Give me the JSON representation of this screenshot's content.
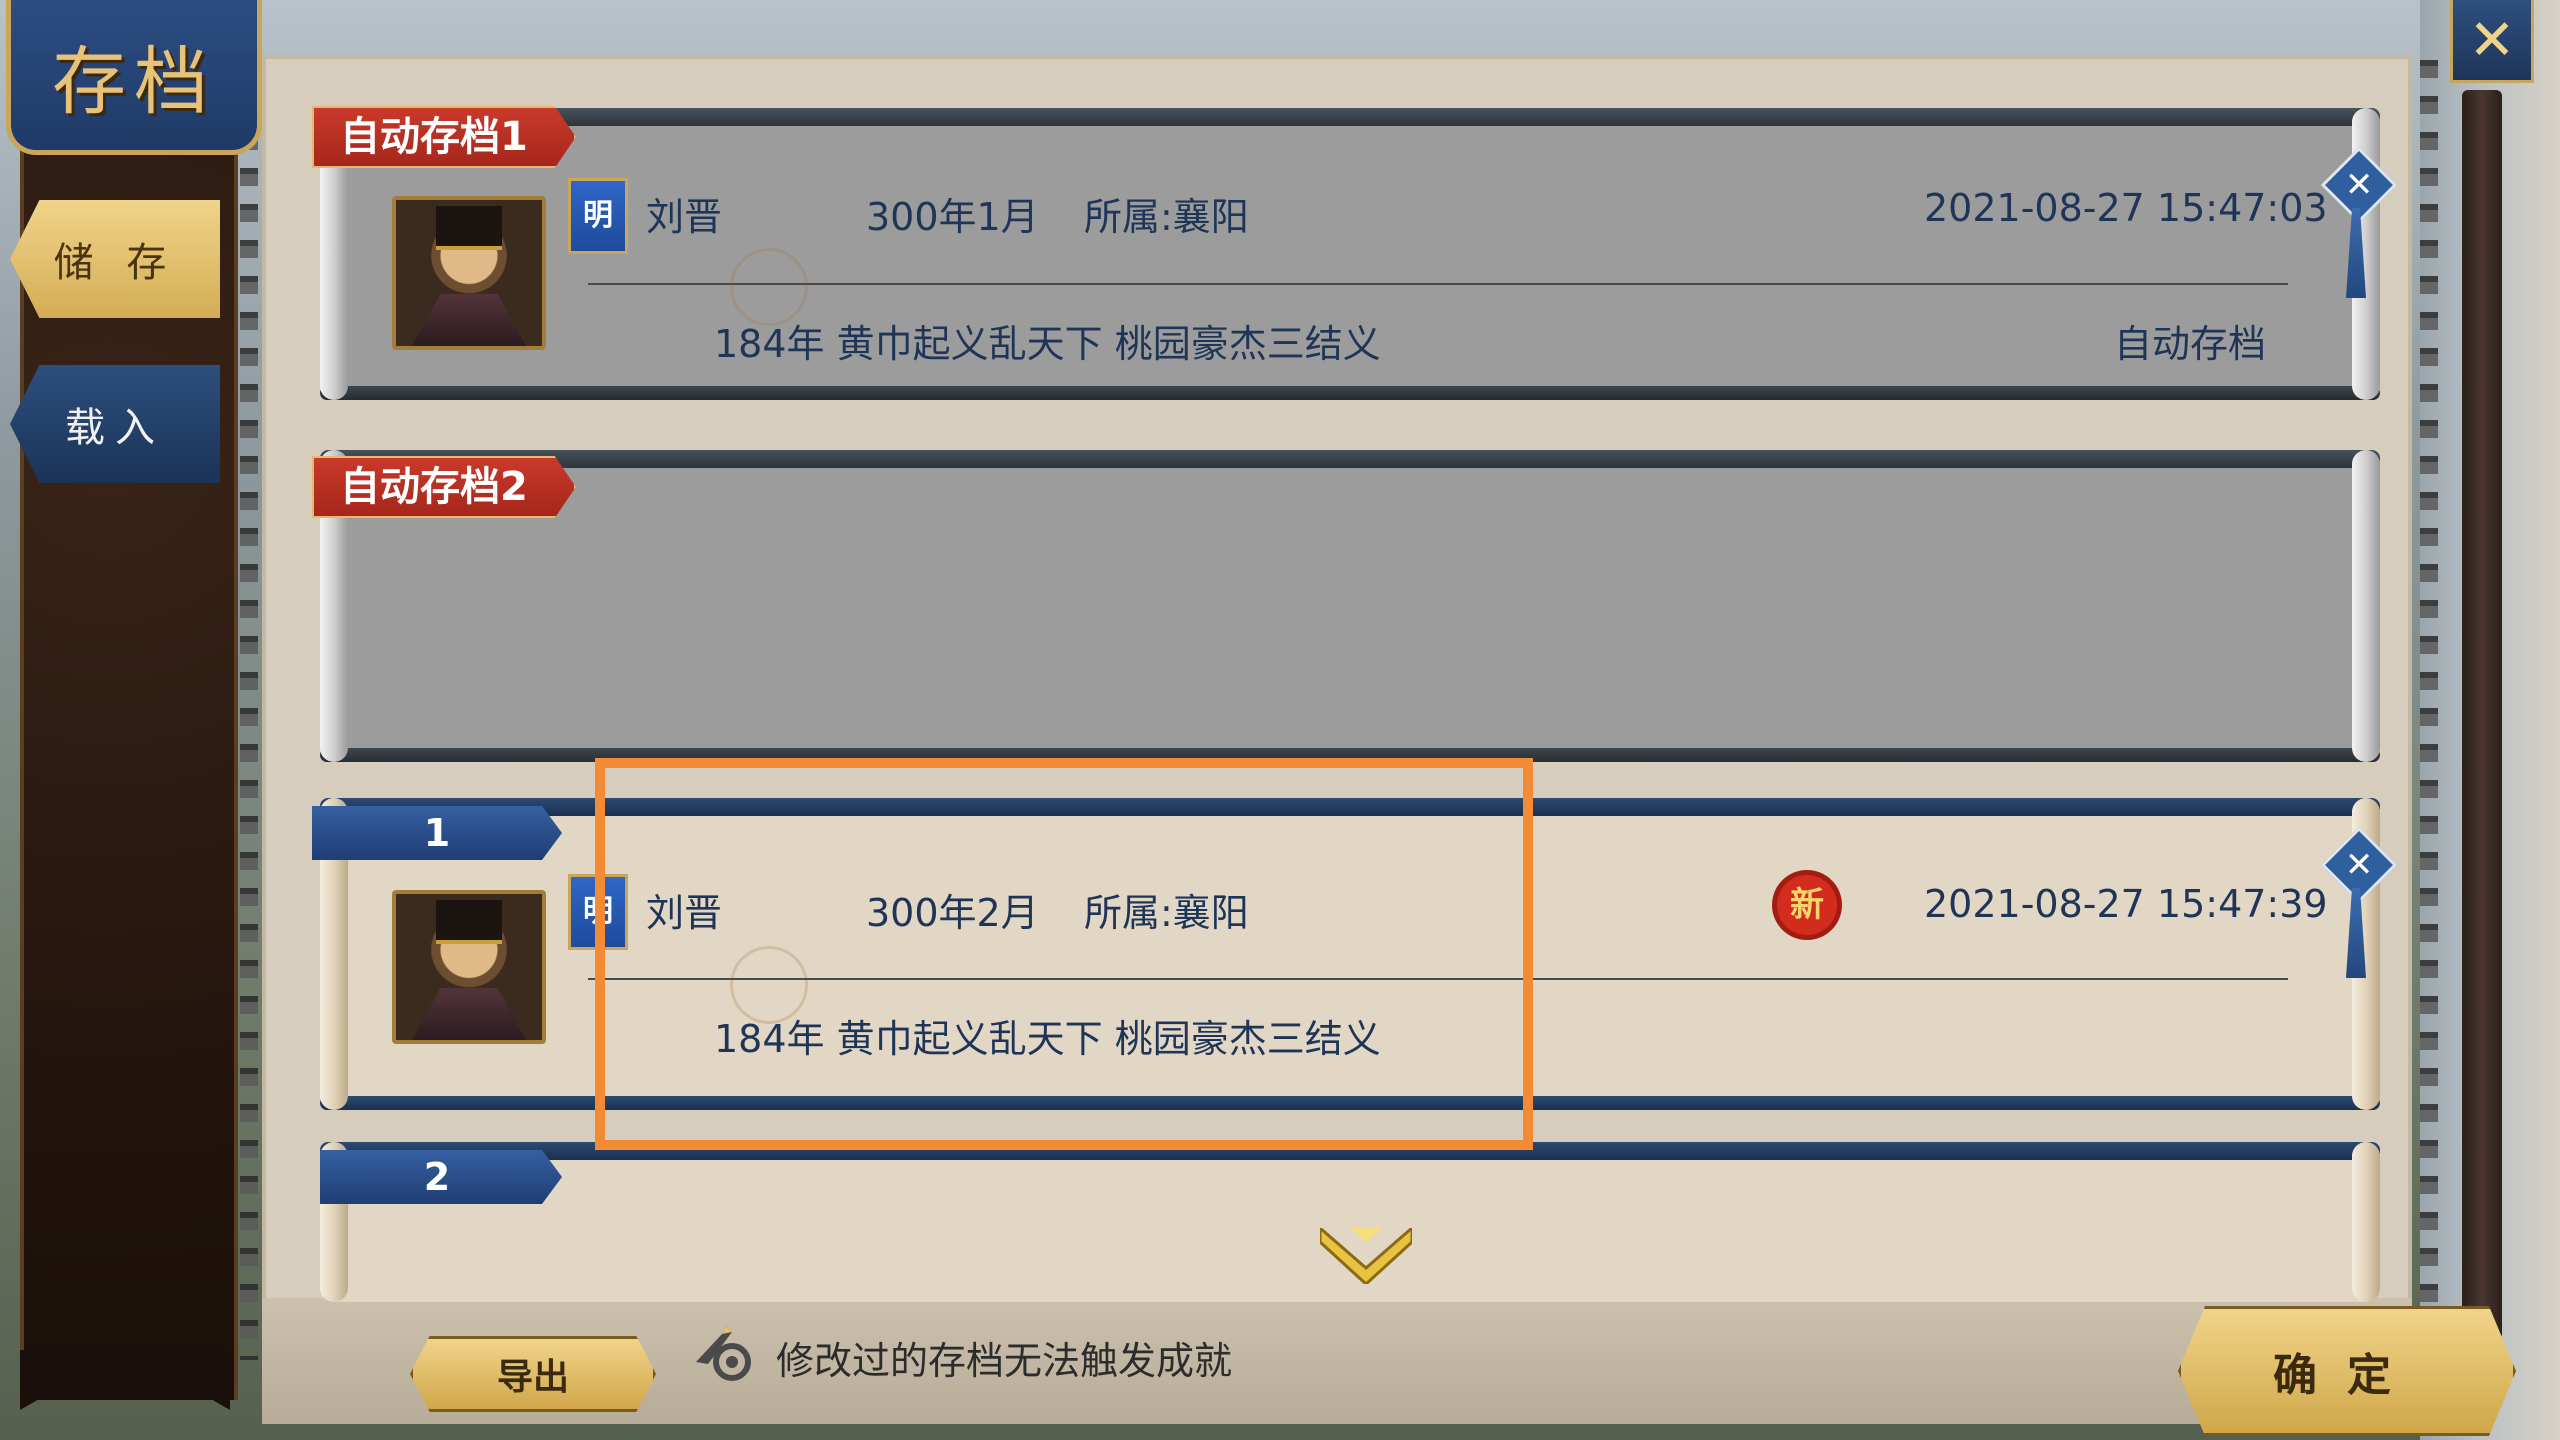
{
  "title": "存档",
  "close_label": "✕",
  "sidebar": {
    "save_label": "储 存",
    "load_label": "载入"
  },
  "auto_saves": [
    {
      "tab": "自动存档1",
      "dynasty_badge": "明",
      "ruler": "刘晋",
      "date": "300年1月",
      "location": "所属:襄阳",
      "timestamp": "2021-08-27   15:47:03",
      "scenario": "184年   黄巾起义乱天下 桃园豪杰三结义",
      "note": "自动存档",
      "delete_icon": "✕"
    },
    {
      "tab": "自动存档2"
    }
  ],
  "slots": [
    {
      "number": "1",
      "dynasty_badge": "明",
      "ruler": "刘晋",
      "date": "300年2月",
      "location": "所属:襄阳",
      "new_badge": "新",
      "timestamp": "2021-08-27   15:47:39",
      "scenario": "184年   黄巾起义乱天下 桃园豪杰三结义",
      "delete_icon": "✕"
    },
    {
      "number": "2"
    }
  ],
  "footer": {
    "export_label": "导出",
    "warning": "修改过的存档无法触发成就",
    "confirm_label": "确定"
  },
  "colors": {
    "highlight": "#f28b34",
    "tab_red": "#b8301f",
    "tab_blue": "#2b5291",
    "gold": "#e2c06e"
  }
}
